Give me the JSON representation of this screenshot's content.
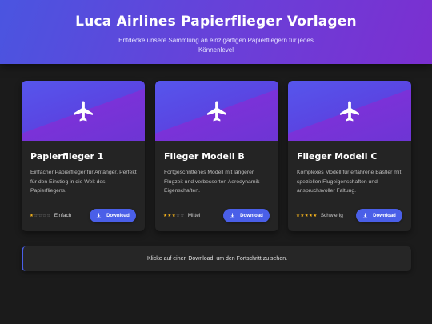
{
  "header": {
    "title": "Luca Airlines Papierflieger Vorlagen",
    "subtitle": "Entdecke unsere Sammlung an einzigartigen Papierfliegern für jedes Könnenlevel"
  },
  "cards": [
    {
      "icon": "airplane-icon",
      "title": "Papierflieger 1",
      "description": "Einfacher Papierflieger für Anfänger. Perfekt für den Einstieg in die Welt des Papierfliegens.",
      "stars_filled": 1,
      "stars_total": 5,
      "level": "Einfach",
      "button_label": "Download"
    },
    {
      "icon": "airplane-icon",
      "title": "Flieger Modell B",
      "description": "Fortgeschrittenes Modell mit längerer Flugzeit und verbesserten Aerodynamik-Eigenschaften.",
      "stars_filled": 3,
      "stars_total": 5,
      "level": "Mittel",
      "button_label": "Download"
    },
    {
      "icon": "airplane-icon",
      "title": "Flieger Modell C",
      "description": "Komplexes Modell für erfahrene Bastler mit speziellen Flugeigenschaften und anspruchsvoller Faltung.",
      "stars_filled": 5,
      "stars_total": 5,
      "level": "Schwierig",
      "button_label": "Download"
    }
  ],
  "status": {
    "message": "Klicke auf einen Download, um den Fortschritt zu sehen."
  },
  "colors": {
    "accent": "#4a5fe8",
    "star": "#f2b11c",
    "background": "#1b1b1b",
    "card": "#242424"
  }
}
